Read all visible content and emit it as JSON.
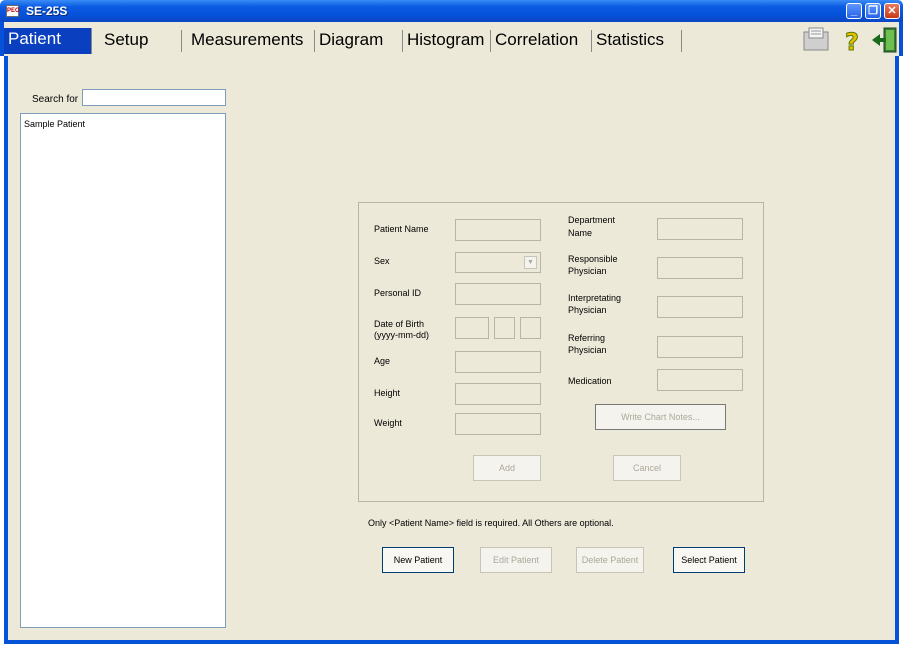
{
  "window": {
    "title": "SE-25S",
    "app_icon_text": "PEO"
  },
  "tabs": [
    {
      "label": "Patient",
      "active": true
    },
    {
      "label": "Setup"
    },
    {
      "label": "Measurements"
    },
    {
      "label": "Diagram"
    },
    {
      "label": "Histogram"
    },
    {
      "label": "Correlation"
    },
    {
      "label": "Statistics"
    }
  ],
  "toolbar_icons": [
    "print-icon",
    "help-icon",
    "exit-icon"
  ],
  "search": {
    "label": "Search for",
    "value": ""
  },
  "patient_list": {
    "items": [
      "Sample Patient"
    ]
  },
  "form": {
    "patient_name": "Patient Name",
    "sex": "Sex",
    "personal_id": "Personal ID",
    "dob": "Date of Birth",
    "dob_format": "(yyyy-mm-dd)",
    "age": "Age",
    "height": "Height",
    "weight": "Weight",
    "department_1": "Department",
    "department_2": "Name",
    "responsible_1": "Responsible",
    "responsible_2": "Physician",
    "interpreting_1": "Interpretating",
    "interpreting_2": "Physician",
    "referring_1": "Referring",
    "referring_2": "Physician",
    "medication": "Medication",
    "write_chart_notes": "Write Chart Notes...",
    "add": "Add",
    "cancel": "Cancel"
  },
  "note": "Only <Patient Name> field is required. All Others are optional.",
  "actions": {
    "new_patient": "New Patient",
    "edit_patient": "Edit Patient",
    "delete_patient": "Delete Patient",
    "select_patient": "Select Patient"
  },
  "colors": {
    "titlebar": "#0551d8",
    "active_tab": "#0a3fbf",
    "panel": "#ece9d8"
  }
}
